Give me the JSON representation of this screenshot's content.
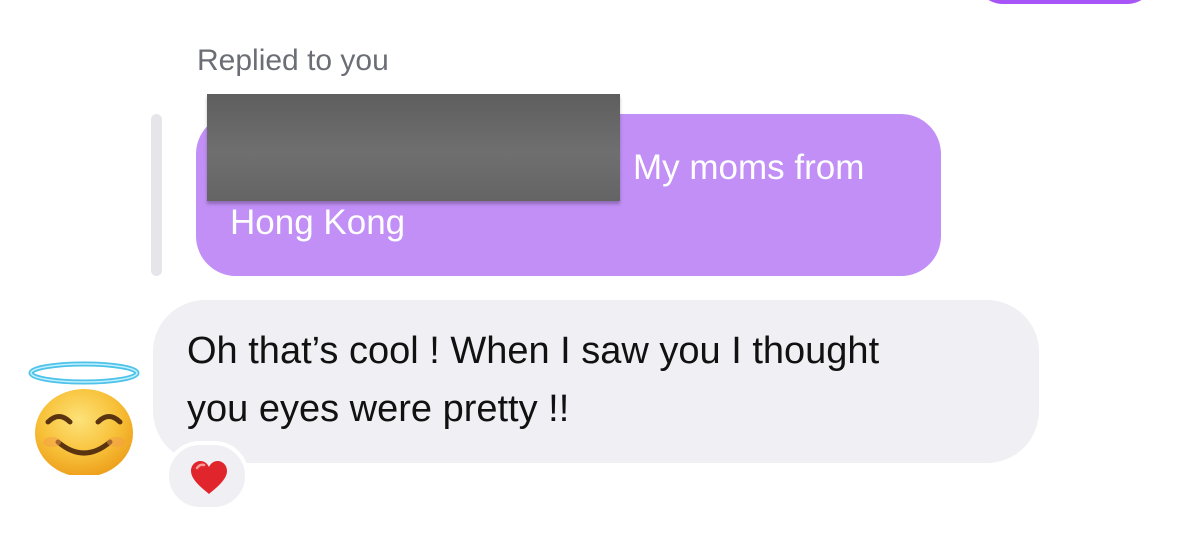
{
  "thread": {
    "reply_label": "Replied to you",
    "quoted_message": {
      "line1": "My moms from",
      "line2": "Hong Kong",
      "redacted": true
    },
    "message": {
      "line1": "Oh that’s cool ! When I saw you I thought",
      "line2": "you eyes were pretty !!"
    },
    "avatar": {
      "icon": "smiling-face-with-halo-icon"
    },
    "reaction": {
      "icon": "red-heart-icon"
    }
  },
  "colors": {
    "sent_bubble": "#a855f7",
    "quoted_bubble": "#c18ff5",
    "received_bubble": "#efeff4",
    "reply_label": "#6b6e75"
  }
}
